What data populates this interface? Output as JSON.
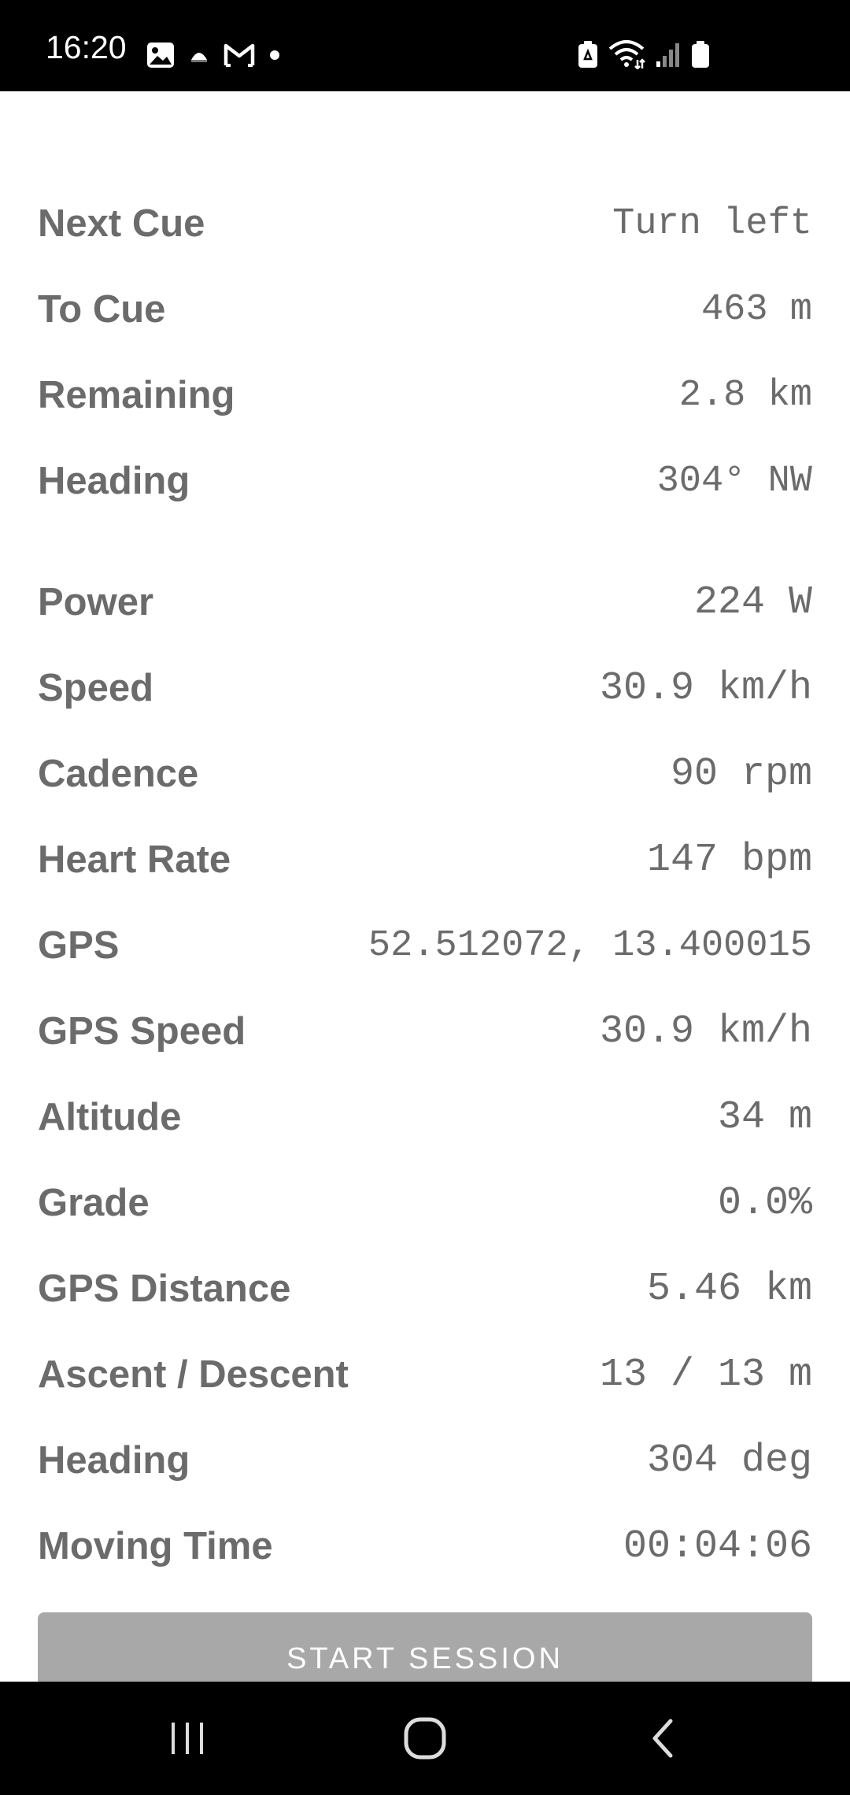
{
  "status_bar": {
    "time": "16:20",
    "left_icons": [
      "gallery-icon",
      "notification-icon",
      "gmail-icon",
      "dot-icon"
    ],
    "right_icons": [
      "battery-saver-icon",
      "wifi-icon",
      "signal-icon",
      "battery-icon"
    ]
  },
  "navigation_info": [
    {
      "label": "Next Cue",
      "value": "Turn left"
    },
    {
      "label": "To Cue",
      "value": "463 m"
    },
    {
      "label": "Remaining",
      "value": "2.8 km"
    },
    {
      "label": "Heading",
      "value": "304° NW"
    }
  ],
  "metrics": [
    {
      "label": "Power",
      "value": "224 W"
    },
    {
      "label": "Speed",
      "value": "30.9 km/h"
    },
    {
      "label": "Cadence",
      "value": "90 rpm"
    },
    {
      "label": "Heart Rate",
      "value": "147 bpm"
    },
    {
      "label": "GPS",
      "value": "52.512072, 13.400015"
    },
    {
      "label": "GPS Speed",
      "value": "30.9 km/h"
    },
    {
      "label": "Altitude",
      "value": "34 m"
    },
    {
      "label": "Grade",
      "value": "0.0%"
    },
    {
      "label": "GPS Distance",
      "value": "5.46 km"
    },
    {
      "label": "Ascent / Descent",
      "value": "13 / 13 m"
    },
    {
      "label": "Heading",
      "value": "304 deg"
    },
    {
      "label": "Moving Time",
      "value": "00:04:06"
    }
  ],
  "start_button": {
    "label": "START SESSION",
    "state": "disabled"
  },
  "nav_bar": {
    "buttons": [
      "recents-button",
      "home-button",
      "back-button"
    ]
  },
  "colors": {
    "text": "#6b6b6b",
    "button_bg": "#a8a8a8",
    "bar_bg": "#000000",
    "panel_bg": "#ffffff"
  }
}
